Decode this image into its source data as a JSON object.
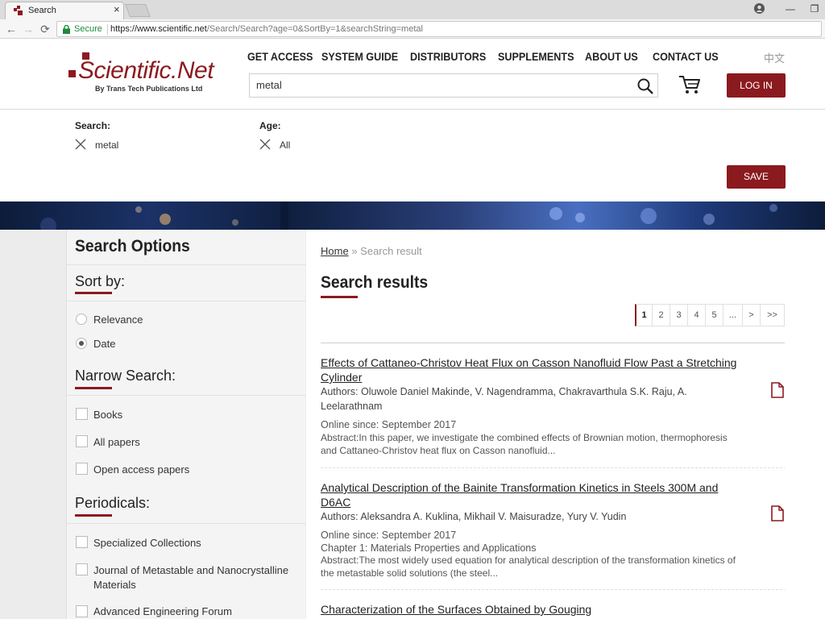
{
  "browser": {
    "tab_title": "Search",
    "tab_close": "×",
    "secure_label": "Secure",
    "url_host": "https://www.scientific.net",
    "url_path": "/Search/Search?age=0&SortBy=1&searchString=metal",
    "win_minimize": "—",
    "win_restore": "❐",
    "nav_back": "←",
    "nav_forward": "→",
    "nav_reload": "⟳"
  },
  "header": {
    "logo_name": "Scientific.Net",
    "logo_by": "By Trans Tech Publications Ltd",
    "nav": [
      "GET ACCESS",
      "SYSTEM GUIDE",
      "DISTRIBUTORS",
      "SUPPLEMENTS",
      "ABOUT US",
      "CONTACT US"
    ],
    "lang": "中文",
    "search_value": "metal",
    "login_label": "LOG IN"
  },
  "filters": {
    "search_label": "Search:",
    "search_value": "metal",
    "age_label": "Age:",
    "age_value": "All",
    "save_label": "SAVE"
  },
  "sidebar": {
    "title": "Search Options",
    "sort_heading": "Sort by:",
    "sort_options": [
      {
        "label": "Relevance",
        "selected": false
      },
      {
        "label": "Date",
        "selected": true
      }
    ],
    "narrow_heading": "Narrow Search:",
    "narrow_options": [
      "Books",
      "All papers",
      "Open access papers"
    ],
    "periodicals_heading": "Periodicals:",
    "periodicals": [
      "Specialized Collections",
      "Journal of Metastable and Nanocrystalline Materials",
      "Advanced Engineering Forum"
    ]
  },
  "main": {
    "breadcrumb_home": "Home",
    "breadcrumb_sep": "»",
    "breadcrumb_current": "Search result",
    "title": "Search results",
    "pagination": [
      "1",
      "2",
      "3",
      "4",
      "5",
      "...",
      ">",
      ">>"
    ],
    "current_page": "1",
    "results": [
      {
        "title": "Effects of Cattaneo-Christov Heat Flux on Casson Nanofluid Flow Past a Stretching Cylinder",
        "authors": "Authors: Oluwole Daniel Makinde, V. Nagendramma, Chakravarthula S.K. Raju, A. Leelarathnam",
        "online": "Online since: September 2017",
        "chapter": "",
        "abstract": "Abstract:In this paper, we investigate the combined effects of Brownian motion, thermophoresis and Cattaneo-Christov heat flux on Casson nanofluid..."
      },
      {
        "title": "Analytical Description of the Bainite Transformation Kinetics in Steels 300M and D6AC",
        "authors": "Authors: Aleksandra A. Kuklina, Mikhail V. Maisuradze, Yury V. Yudin",
        "online": "Online since: September 2017",
        "chapter": "Chapter 1: Materials Properties and Applications",
        "abstract": "Abstract:The most widely used equation for analytical description of the transformation kinetics of the metastable solid solutions (the steel..."
      },
      {
        "title": "Characterization of the Surfaces Obtained by Gouging",
        "authors": "",
        "online": "",
        "chapter": "",
        "abstract": ""
      }
    ]
  },
  "colors": {
    "brand": "#8b1a1f"
  }
}
